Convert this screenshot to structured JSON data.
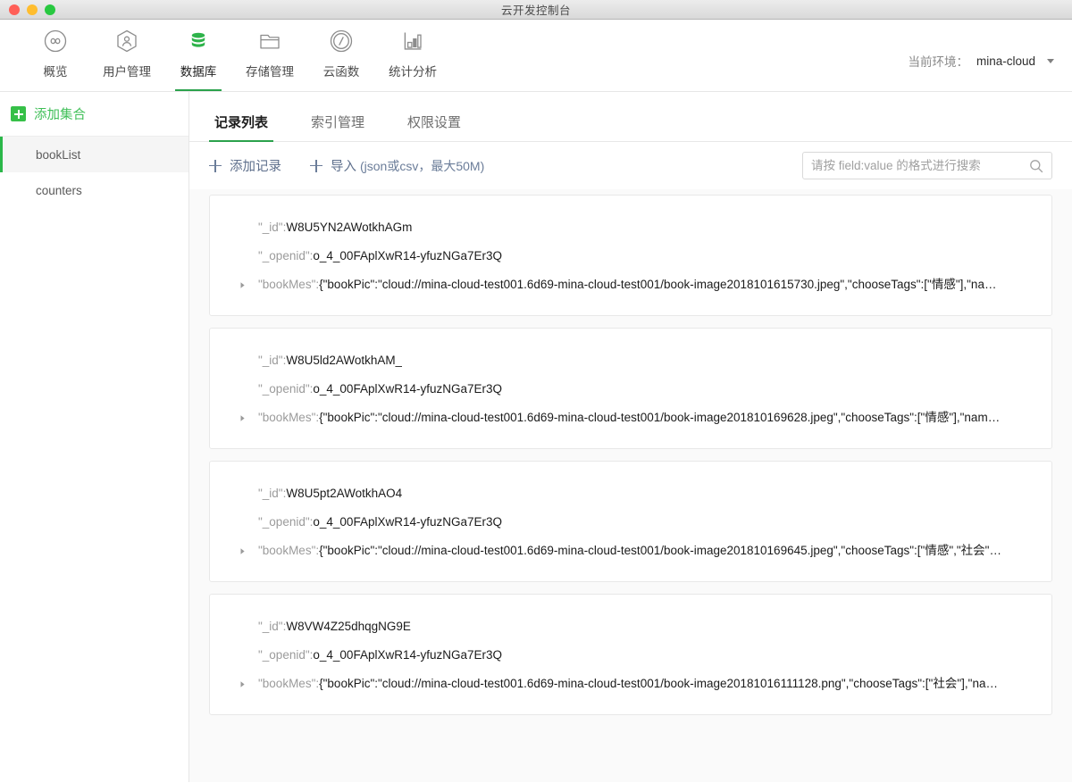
{
  "window": {
    "title": "云开发控制台",
    "traffic_lights": [
      "close-red",
      "minimize-yellow",
      "zoom-green"
    ]
  },
  "topnav": {
    "items": [
      {
        "label": "概览",
        "icon": "infinity-circle-icon",
        "active": false
      },
      {
        "label": "用户管理",
        "icon": "user-hexagon-icon",
        "active": false
      },
      {
        "label": "数据库",
        "icon": "database-icon",
        "active": true
      },
      {
        "label": "存储管理",
        "icon": "folder-icon",
        "active": false
      },
      {
        "label": "云函数",
        "icon": "slash-circle-icon",
        "active": false
      },
      {
        "label": "统计分析",
        "icon": "bar-chart-icon",
        "active": false
      }
    ],
    "env_label": "当前环境：",
    "env_value": "mina-cloud",
    "env_caret_icon": "chevron-down-icon",
    "active_color": "#2ba24c"
  },
  "sidebar": {
    "add_collection_label": "添加集合",
    "add_icon": "plus-square-icon",
    "collections": [
      {
        "name": "bookList",
        "active": true
      },
      {
        "name": "counters",
        "active": false
      }
    ]
  },
  "main": {
    "tabs": [
      {
        "label": "记录列表",
        "active": true
      },
      {
        "label": "索引管理",
        "active": false
      },
      {
        "label": "权限设置",
        "active": false
      }
    ],
    "toolbar": {
      "add_record_label": "添加记录",
      "import_label": "导入",
      "import_hint": "(json或csv，最大50M)",
      "add_icon": "plus-icon",
      "import_icon": "plus-icon"
    },
    "search": {
      "placeholder": "请按 field:value 的格式进行搜索",
      "value": "",
      "icon": "search-icon"
    },
    "records": [
      {
        "id_key": "\"_id\":",
        "id_value": "W8U5YN2AWotkhAGm",
        "openid_key": "\"_openid\":",
        "openid_value": "o_4_00FAplXwR14-yfuzNGa7Er3Q",
        "bookmes_key": "\"bookMes\":",
        "bookmes_value": "{\"bookPic\":\"cloud://mina-cloud-test001.6d69-mina-cloud-test001/book-image2018101615730.jpeg\",\"chooseTags\":[\"情感\"],\"na…",
        "expand_icon": "triangle-right-icon"
      },
      {
        "id_key": "\"_id\":",
        "id_value": "W8U5ld2AWotkhAM_",
        "openid_key": "\"_openid\":",
        "openid_value": "o_4_00FAplXwR14-yfuzNGa7Er3Q",
        "bookmes_key": "\"bookMes\":",
        "bookmes_value": "{\"bookPic\":\"cloud://mina-cloud-test001.6d69-mina-cloud-test001/book-image201810169628.jpeg\",\"chooseTags\":[\"情感\"],\"nam…",
        "expand_icon": "triangle-right-icon"
      },
      {
        "id_key": "\"_id\":",
        "id_value": "W8U5pt2AWotkhAO4",
        "openid_key": "\"_openid\":",
        "openid_value": "o_4_00FAplXwR14-yfuzNGa7Er3Q",
        "bookmes_key": "\"bookMes\":",
        "bookmes_value": "{\"bookPic\":\"cloud://mina-cloud-test001.6d69-mina-cloud-test001/book-image201810169645.jpeg\",\"chooseTags\":[\"情感\",\"社会\"…",
        "expand_icon": "triangle-right-icon"
      },
      {
        "id_key": "\"_id\":",
        "id_value": "W8VW4Z25dhqgNG9E",
        "openid_key": "\"_openid\":",
        "openid_value": "o_4_00FAplXwR14-yfuzNGa7Er3Q",
        "bookmes_key": "\"bookMes\":",
        "bookmes_value": "{\"bookPic\":\"cloud://mina-cloud-test001.6d69-mina-cloud-test001/book-image20181016111128.png\",\"chooseTags\":[\"社会\"],\"na…",
        "expand_icon": "triangle-right-icon"
      }
    ]
  }
}
